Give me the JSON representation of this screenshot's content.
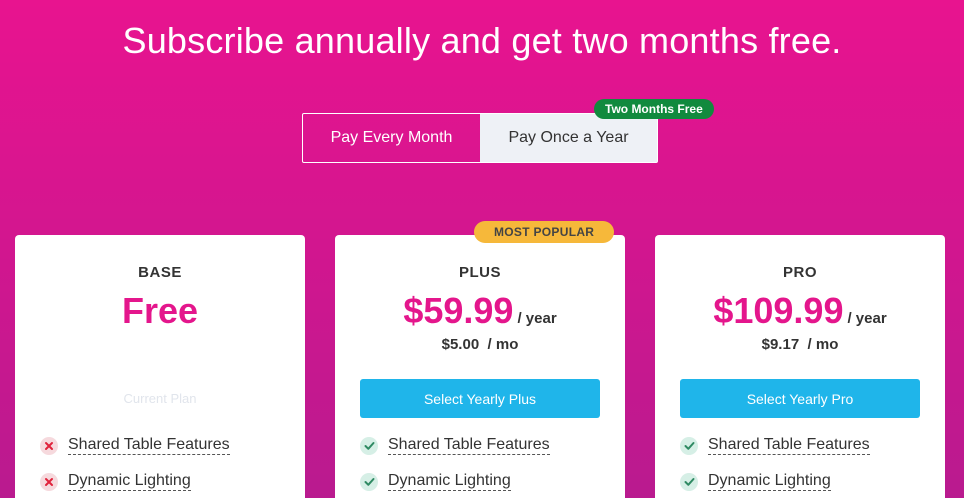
{
  "headline": "Subscribe annually and get two months free.",
  "billing_toggle": {
    "monthly_label": "Pay Every Month",
    "yearly_label": "Pay Once a Year",
    "yearly_badge": "Two Months Free"
  },
  "colors": {
    "brand": "#e4168c",
    "button": "#1fb5ea",
    "badge_green": "#118a3e",
    "badge_popular": "#f6b83a"
  },
  "plans": [
    {
      "name": "BASE",
      "price": "Free",
      "status": "Current Plan",
      "features": [
        {
          "label": "Shared Table Features",
          "included": false,
          "icon": "x-icon"
        },
        {
          "label": "Dynamic Lighting",
          "included": false,
          "icon": "x-icon"
        }
      ]
    },
    {
      "name": "PLUS",
      "badge": "MOST POPULAR",
      "price": "$59.99",
      "period": "/ year",
      "monthly_price": "$5.00",
      "monthly_period": "/ mo",
      "button_label": "Select Yearly Plus",
      "features": [
        {
          "label": "Shared Table Features",
          "included": true,
          "icon": "check-icon"
        },
        {
          "label": "Dynamic Lighting",
          "included": true,
          "icon": "check-icon"
        }
      ]
    },
    {
      "name": "PRO",
      "price": "$109.99",
      "period": "/ year",
      "monthly_price": "$9.17",
      "monthly_period": "/ mo",
      "button_label": "Select Yearly Pro",
      "features": [
        {
          "label": "Shared Table Features",
          "included": true,
          "icon": "check-icon"
        },
        {
          "label": "Dynamic Lighting",
          "included": true,
          "icon": "check-icon"
        }
      ]
    }
  ]
}
